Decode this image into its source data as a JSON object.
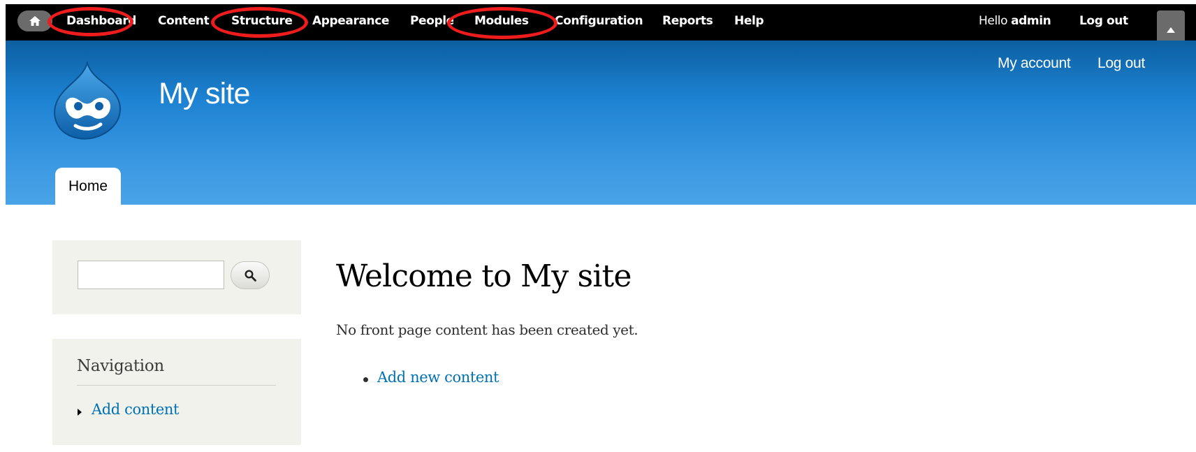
{
  "toolbar": {
    "items": [
      {
        "label": "Dashboard"
      },
      {
        "label": "Content"
      },
      {
        "label": "Structure"
      },
      {
        "label": "Appearance"
      },
      {
        "label": "People"
      },
      {
        "label": "Modules"
      },
      {
        "label": "Configuration"
      },
      {
        "label": "Reports"
      },
      {
        "label": "Help"
      }
    ],
    "hello_prefix": "Hello ",
    "hello_user": "admin",
    "logout": "Log out",
    "icons": {
      "home": "home-icon",
      "toggle": "triangle-up-icon"
    },
    "highlight_color": "#ee1c1c"
  },
  "header": {
    "secondary_menu": [
      {
        "label": "My account"
      },
      {
        "label": "Log out"
      }
    ],
    "site_name": "My site",
    "home_tab": "Home",
    "logo": "drupal-drop-logo"
  },
  "sidebar": {
    "search_button_icon": "search-icon",
    "navigation": {
      "title": "Navigation",
      "items": [
        {
          "label": "Add content"
        }
      ]
    }
  },
  "main": {
    "title": "Welcome to My site",
    "message": "No front page content has been created yet.",
    "links": [
      {
        "label": "Add new content"
      }
    ]
  },
  "colors": {
    "toolbar_bg": "#000000",
    "header_top": "#0c5fa0",
    "header_bottom": "#4aa3e6",
    "link": "#0071b3",
    "sidebar_bg": "#f2f2ec"
  }
}
